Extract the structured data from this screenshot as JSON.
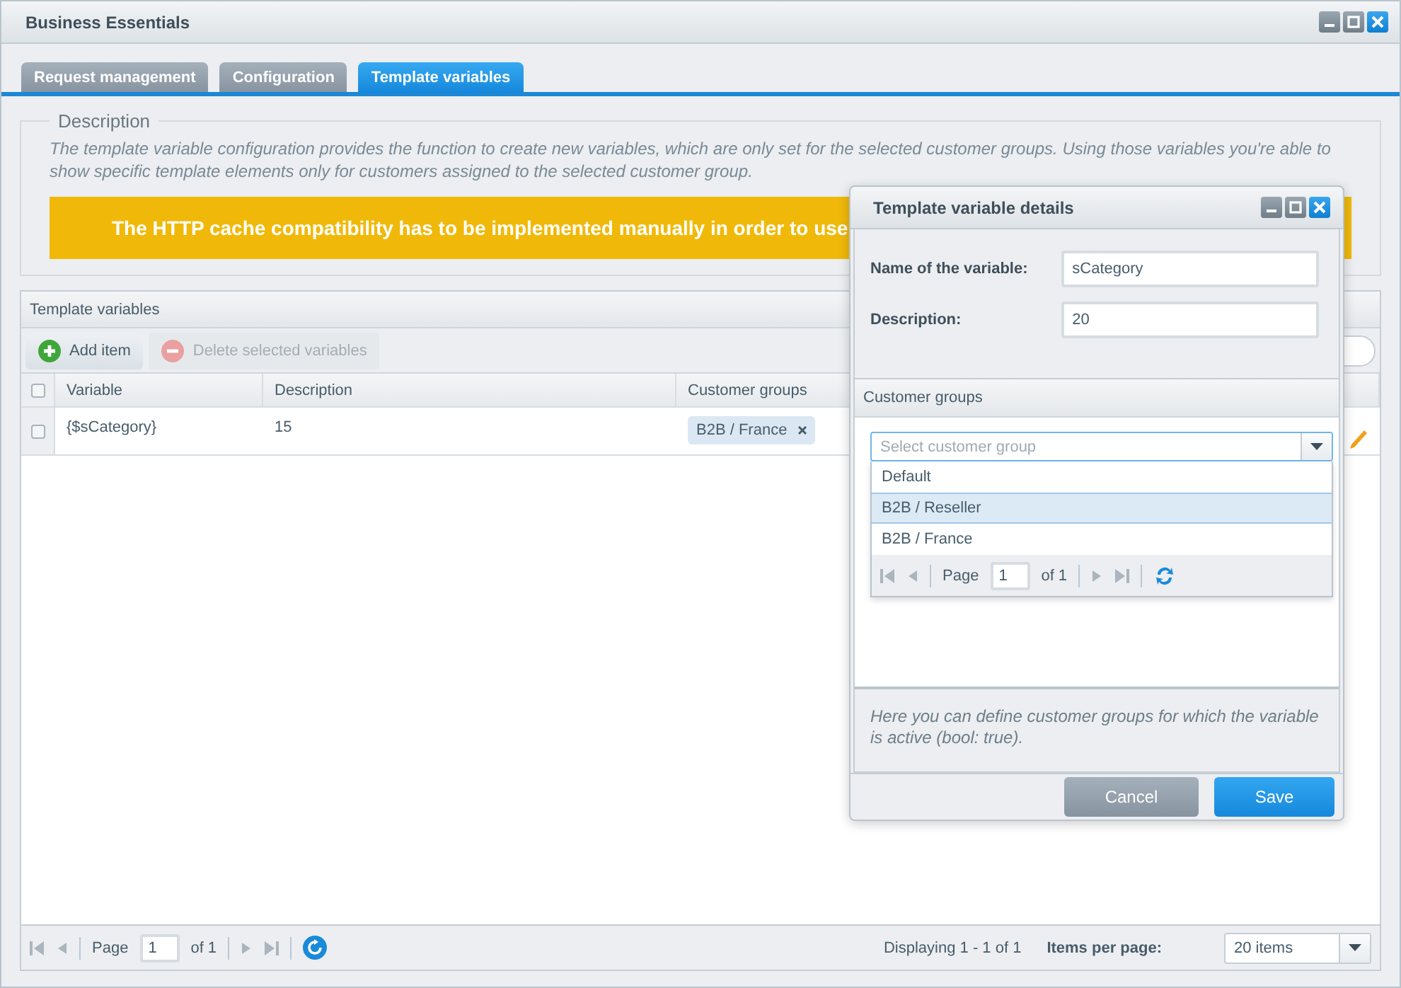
{
  "window": {
    "title": "Business Essentials"
  },
  "tabs": [
    {
      "label": "Request management",
      "selected": false
    },
    {
      "label": "Configuration",
      "selected": false
    },
    {
      "label": "Template variables",
      "selected": true
    }
  ],
  "description": {
    "legend": "Description",
    "text": "The template variable configuration provides the function to create new variables, which are only set for the selected customer groups. Using those variables you're able to show specific template elements only for customers assigned to the selected customer group.",
    "warning": "The HTTP cache compatibility has to be implemented manually in order to use"
  },
  "grid": {
    "title": "Template variables",
    "toolbar": [
      {
        "label": "Add item",
        "kind": "add",
        "disabled": false
      },
      {
        "label": "Delete selected variables",
        "kind": "delete",
        "disabled": true
      }
    ],
    "select_all": {
      "checked": false
    },
    "columns": [
      "Variable",
      "Description",
      "Customer groups"
    ],
    "rows": [
      {
        "checked": false,
        "variable": "{$sCategory}",
        "description": "15",
        "groups": [
          "B2B / France"
        ]
      }
    ],
    "pager": {
      "page_label": "Page",
      "page": "1",
      "of": "of 1",
      "displaying": "Displaying 1 - 1 of 1",
      "per_page_label": "Items per page:",
      "per_page": "20 items"
    }
  },
  "dialog": {
    "title": "Template variable details",
    "fields": [
      {
        "label": "Name of the variable:",
        "value": "sCategory"
      },
      {
        "label": "Description:",
        "value": "20"
      }
    ],
    "customer_groups": {
      "title": "Customer groups",
      "placeholder": "Select customer group",
      "options": [
        {
          "label": "Default",
          "selected": false
        },
        {
          "label": "B2B / Reseller",
          "selected": true
        },
        {
          "label": "B2B / France",
          "selected": false
        }
      ],
      "pager": {
        "page_label": "Page",
        "page": "1",
        "of": "of 1"
      },
      "help": "Here you can define customer groups for which the variable is active (bool: true)."
    },
    "buttons": [
      {
        "label": "Cancel",
        "kind": "secondary"
      },
      {
        "label": "Save",
        "kind": "primary"
      }
    ]
  }
}
